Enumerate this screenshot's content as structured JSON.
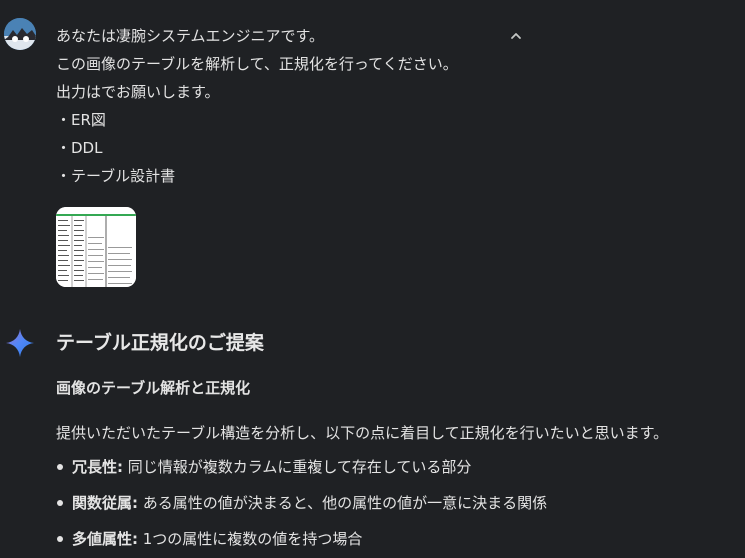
{
  "user_message": {
    "lines": [
      "あなたは凄腕システムエンジニアです。",
      "この画像のテーブルを解析して、正規化を行ってください。",
      "出力はでお願いします。",
      "・ER図",
      "・DDL",
      "・テーブル設計書"
    ]
  },
  "response": {
    "title": "テーブル正規化のご提案",
    "subtitle": "画像のテーブル解析と正規化",
    "intro": "提供いただいたテーブル構造を分析し、以下の点に着目して正規化を行いたいと思います。",
    "bullets": [
      {
        "term": "冗長性:",
        "text": " 同じ情報が複数カラムに重複して存在している部分"
      },
      {
        "term": "関数従属:",
        "text": " ある属性の値が決まると、他の属性の値が一意に決まる関係"
      },
      {
        "term": "多値属性:",
        "text": " 1つの属性に複数の値を持つ場合"
      }
    ]
  },
  "icons": {
    "avatar": "user-avatar",
    "collapse": "chevron-up-icon",
    "assistant": "sparkle-icon",
    "attachment": "image-thumbnail"
  },
  "colors": {
    "background": "#1f2124",
    "text": "#e3e3e3",
    "thumbnail_accent": "#34a853"
  }
}
